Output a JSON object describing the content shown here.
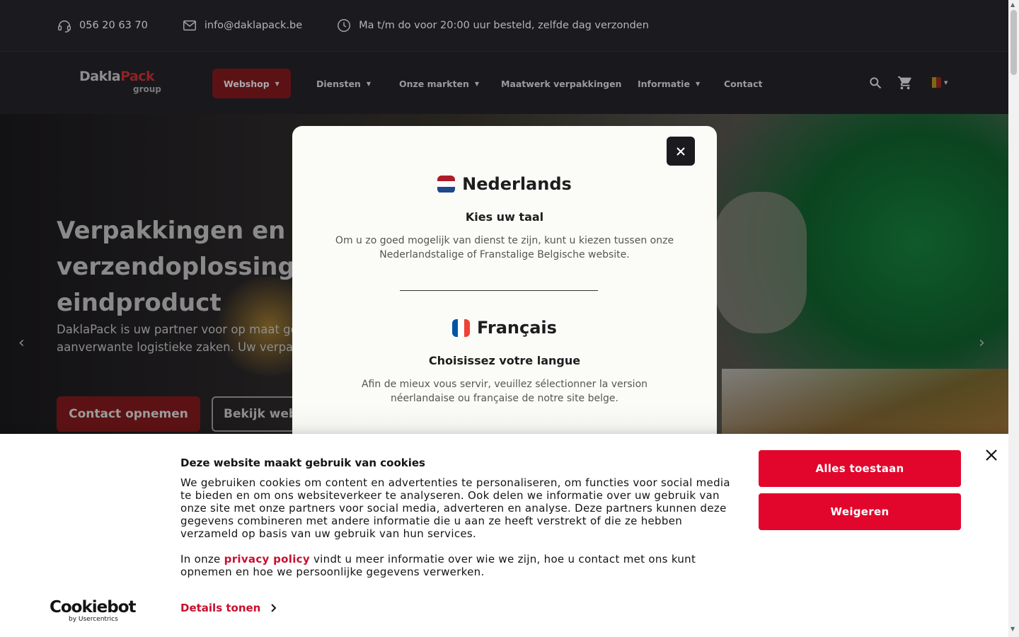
{
  "topbar": {
    "phone": "056 20 63 70",
    "email": "info@daklapack.be",
    "hours": "Ma t/m do voor 20:00 uur besteld, zelfde dag verzonden"
  },
  "nav": {
    "logo_main": "Dakla",
    "logo_accent": "Pack",
    "logo_sub": "group",
    "items": [
      {
        "label": "Webshop",
        "has_caret": true
      },
      {
        "label": "Diensten",
        "has_caret": true
      },
      {
        "label": "Onze markten",
        "has_caret": true
      },
      {
        "label": "Maatwerk verpakkingen",
        "has_caret": false
      },
      {
        "label": "Informatie",
        "has_caret": true
      },
      {
        "label": "Contact",
        "has_caret": false
      }
    ],
    "icons": [
      "search-icon",
      "cart-icon",
      "belgium-flag-icon"
    ]
  },
  "hero": {
    "title": "Verpakkingen en verzendoplossingen eindproduct",
    "text": "DaklaPack is uw partner voor op maat ge aanverwante logistieke zaken. Uw verpakk",
    "btn_contact": "Contact opnemen",
    "btn_web": "Bekijk web"
  },
  "language_modal": {
    "nl": {
      "title": "Nederlands",
      "subtitle": "Kies uw taal",
      "description": "Om u zo goed mogelijk van dienst te zijn, kunt u kiezen tussen onze Nederlandstalige of Franstalige Belgische website."
    },
    "fr": {
      "title": "Français",
      "subtitle": "Choisissez votre langue",
      "description": "Afin de mieux vous servir, veuillez sélectionner la version néerlandaise ou française de notre site belge."
    }
  },
  "cookie": {
    "brand": "Cookiebot",
    "brand_sub": "by Usercentrics",
    "title": "Deze website maakt gebruik van cookies",
    "body": "We gebruiken cookies om content en advertenties te personaliseren, om functies voor social media te bieden en om ons websiteverkeer te analyseren. Ook delen we informatie over uw gebruik van onze site met onze partners voor social media, adverteren en analyse. Deze partners kunnen deze gegevens combineren met andere informatie die u aan ze heeft verstrekt of die ze hebben verzameld op basis van uw gebruik van hun services.",
    "privacy_prefix": "In onze ",
    "privacy_link": "privacy policy",
    "privacy_suffix": " vindt u meer informatie over wie we zijn, hoe u contact met ons kunt opnemen en hoe we persoonlijke gegevens verwerken.",
    "details": "Details tonen",
    "allow_all": "Alles toestaan",
    "deny": "Weigeren"
  },
  "colors": {
    "accent_red": "#e2062c",
    "link_red": "#c8102e",
    "nav_bg": "#19181c",
    "webshop_bg": "#5c1214"
  }
}
